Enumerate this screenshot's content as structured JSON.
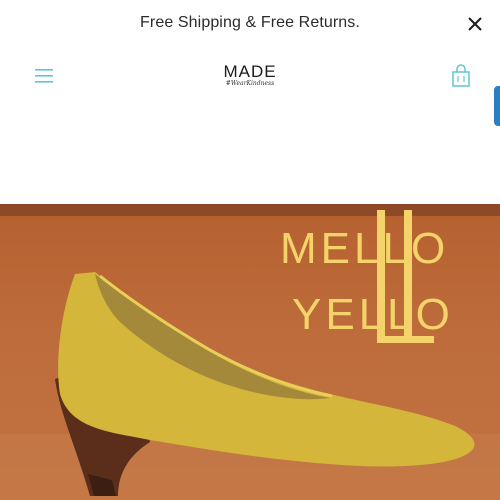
{
  "announcement": {
    "text": "Free Shipping & Free Returns."
  },
  "header": {
    "logo_main": "MADE",
    "logo_tagline": "#WearKindness"
  },
  "hero": {
    "headline_line1": "MELLO",
    "headline_line2": "YELLO",
    "colors": {
      "background": "#c27443",
      "text": "#f4d36b",
      "shoe": "#d4b63a"
    }
  },
  "icons": {
    "close": "close-icon",
    "menu": "hamburger-menu-icon",
    "cart": "shopping-bag-icon"
  },
  "accent": "#5fc5d6"
}
